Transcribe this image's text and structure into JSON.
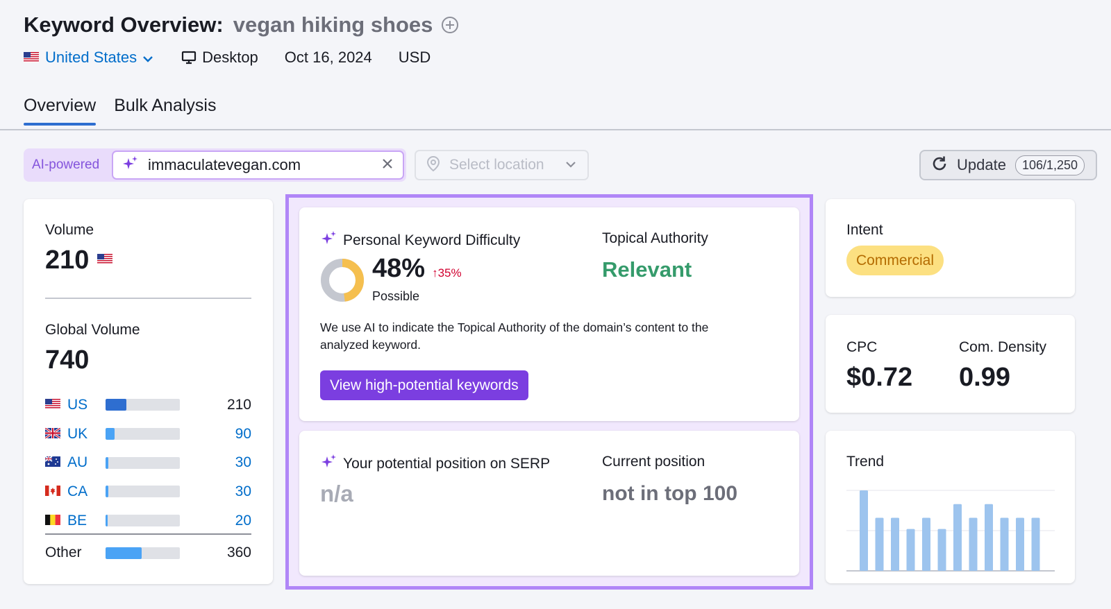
{
  "header": {
    "title_prefix": "Keyword Overview:",
    "keyword": "vegan hiking shoes",
    "country": "United States",
    "device": "Desktop",
    "date": "Oct 16, 2024",
    "currency": "USD"
  },
  "tabs": [
    {
      "label": "Overview",
      "active": true
    },
    {
      "label": "Bulk Analysis",
      "active": false
    }
  ],
  "toolbar": {
    "ai_label": "AI-powered",
    "domain_value": "immaculatevegan.com",
    "location_placeholder": "Select location",
    "update_label": "Update",
    "update_count": "106/1,250"
  },
  "volume": {
    "label": "Volume",
    "value": "210",
    "global_label": "Global Volume",
    "global_value": "740",
    "countries": [
      {
        "code": "US",
        "value": "210",
        "share": 0.28,
        "color": "#2e6ed0"
      },
      {
        "code": "UK",
        "value": "90",
        "share": 0.12,
        "color": "#4aa3f5"
      },
      {
        "code": "AU",
        "value": "30",
        "share": 0.04,
        "color": "#4aa3f5"
      },
      {
        "code": "CA",
        "value": "30",
        "share": 0.04,
        "color": "#4aa3f5"
      },
      {
        "code": "BE",
        "value": "20",
        "share": 0.03,
        "color": "#4aa3f5"
      }
    ],
    "other_label": "Other",
    "other_value": "360",
    "other_share": 0.49
  },
  "difficulty": {
    "label": "Personal Keyword Difficulty",
    "value": "48%",
    "percent": 48,
    "delta": "35%",
    "sub": "Possible",
    "authority_label": "Topical Authority",
    "authority_value": "Relevant",
    "description": "We use AI to indicate the Topical Authority of the domain’s content to the analyzed keyword.",
    "button": "View high-potential keywords"
  },
  "serp": {
    "potential_label": "Your potential position on SERP",
    "potential_value": "n/a",
    "current_label": "Current position",
    "current_value": "not in top 100"
  },
  "intent": {
    "label": "Intent",
    "badge": "Commercial"
  },
  "cpc": {
    "cpc_label": "CPC",
    "cpc_value": "$0.72",
    "density_label": "Com. Density",
    "density_value": "0.99"
  },
  "trend": {
    "label": "Trend",
    "values": [
      1.0,
      0.66,
      0.66,
      0.52,
      0.66,
      0.52,
      0.83,
      0.66,
      0.83,
      0.66,
      0.66,
      0.66
    ]
  },
  "colors": {
    "accent": "#7b3ee0",
    "link": "#006dca",
    "positive": "#359b6b",
    "delta": "#d1002f",
    "trend_bar": "#9dc4ee"
  }
}
